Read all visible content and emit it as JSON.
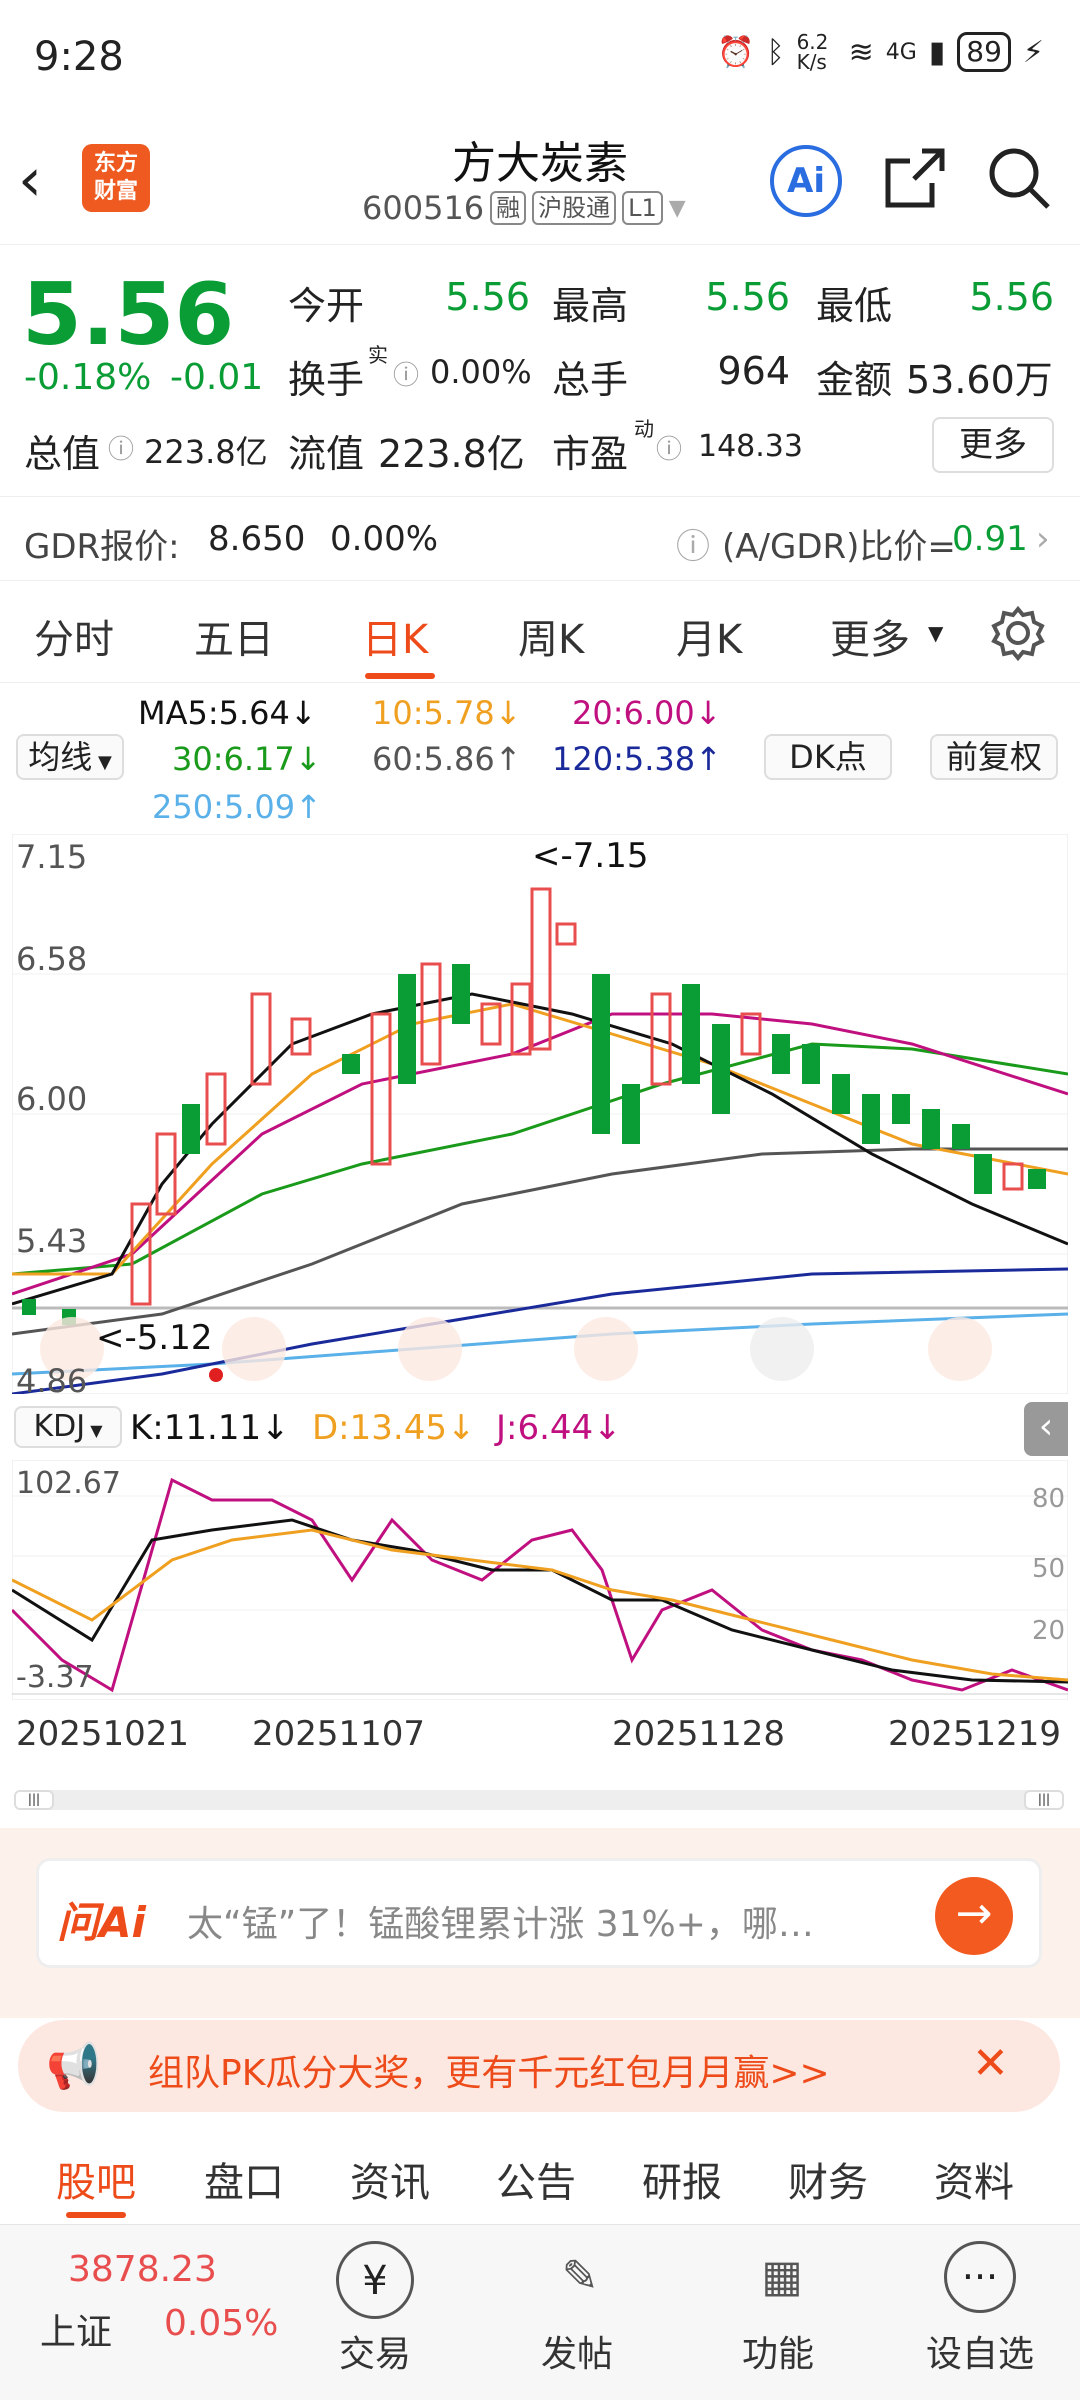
{
  "status_bar": {
    "time": "9:28",
    "net_speed": "6.2 K/s",
    "signal": "4G",
    "battery": "89"
  },
  "header": {
    "logo_line1": "东方",
    "logo_line2": "财富",
    "title": "方大炭素",
    "code": "600516",
    "tags": [
      "融",
      "沪股通",
      "L1"
    ],
    "ai_label": "Ai"
  },
  "quote": {
    "price": "5.56",
    "change_pct": "-0.18%",
    "change": "-0.01",
    "open_label": "今开",
    "open": "5.56",
    "high_label": "最高",
    "high": "5.56",
    "low_label": "最低",
    "low": "5.56",
    "turnover_label": "换手",
    "turnover_sup": "实",
    "turnover": "0.00%",
    "volume_label": "总手",
    "volume": "964",
    "amount_label": "金额",
    "amount": "53.60万",
    "mktcap_label": "总值",
    "mktcap": "223.8亿",
    "float_label": "流值",
    "float": "223.8亿",
    "pe_label": "市盈",
    "pe_sup": "动",
    "pe": "148.33",
    "more": "更多"
  },
  "gdr": {
    "label": "GDR报价:",
    "price": "8.650",
    "pct": "0.00%",
    "ratio_label": "(A/GDR)比价=",
    "ratio": "0.91"
  },
  "tabs": [
    {
      "label": "分时"
    },
    {
      "label": "五日"
    },
    {
      "label": "日K"
    },
    {
      "label": "周K"
    },
    {
      "label": "月K"
    },
    {
      "label": "更多"
    }
  ],
  "indicators": {
    "avg_btn": "均线",
    "dk_btn": "DK点",
    "adj_btn": "前复权",
    "ma5": "MA5:5.64↓",
    "ma10": "10:5.78↓",
    "ma20": "20:6.00↓",
    "ma30": "30:6.17↓",
    "ma60": "60:5.86↑",
    "ma120": "120:5.38↑",
    "ma250": "250:5.09↑"
  },
  "kline": {
    "y_top": "7.15",
    "y_2": "6.58",
    "y_3": "6.00",
    "y_4": "5.43",
    "y_bottom": "4.86",
    "max_label": "<-7.15",
    "min_label": "<-5.12",
    "dates": [
      "20251021",
      "20251107",
      "20251128",
      "20251219"
    ]
  },
  "kdj": {
    "btn": "KDJ",
    "k": "K:11.11↓",
    "d": "D:13.45↓",
    "j": "J:6.44↓",
    "y_top": "102.67",
    "y_bottom": "-3.37",
    "r80": "80",
    "r50": "50",
    "r20": "20"
  },
  "ask_ai": {
    "logo": "问Ai",
    "placeholder": "太“锰”了！锰酸锂累计涨 31%+，哪…"
  },
  "promo": {
    "text": "组队PK瓜分大奖，更有千元红包月月赢>>"
  },
  "bottom_tabs": [
    {
      "label": "股吧"
    },
    {
      "label": "盘口"
    },
    {
      "label": "资讯"
    },
    {
      "label": "公告"
    },
    {
      "label": "研报"
    },
    {
      "label": "财务"
    },
    {
      "label": "资料"
    }
  ],
  "nav": {
    "index_value": "3878.23",
    "index_name": "上证",
    "index_pct": "0.05%",
    "trade": "交易",
    "post": "发帖",
    "func": "功能",
    "watch": "设自选"
  },
  "colors": {
    "up": "#e94e4e",
    "down": "#0a9d36",
    "accent": "#ee4b1a",
    "ma5": "#111111",
    "ma10": "#f0a020",
    "ma20": "#c01080",
    "ma30": "#1a9a1a",
    "ma60": "#555555",
    "ma120": "#1a2a9a",
    "ma250": "#5ab0e8"
  }
}
